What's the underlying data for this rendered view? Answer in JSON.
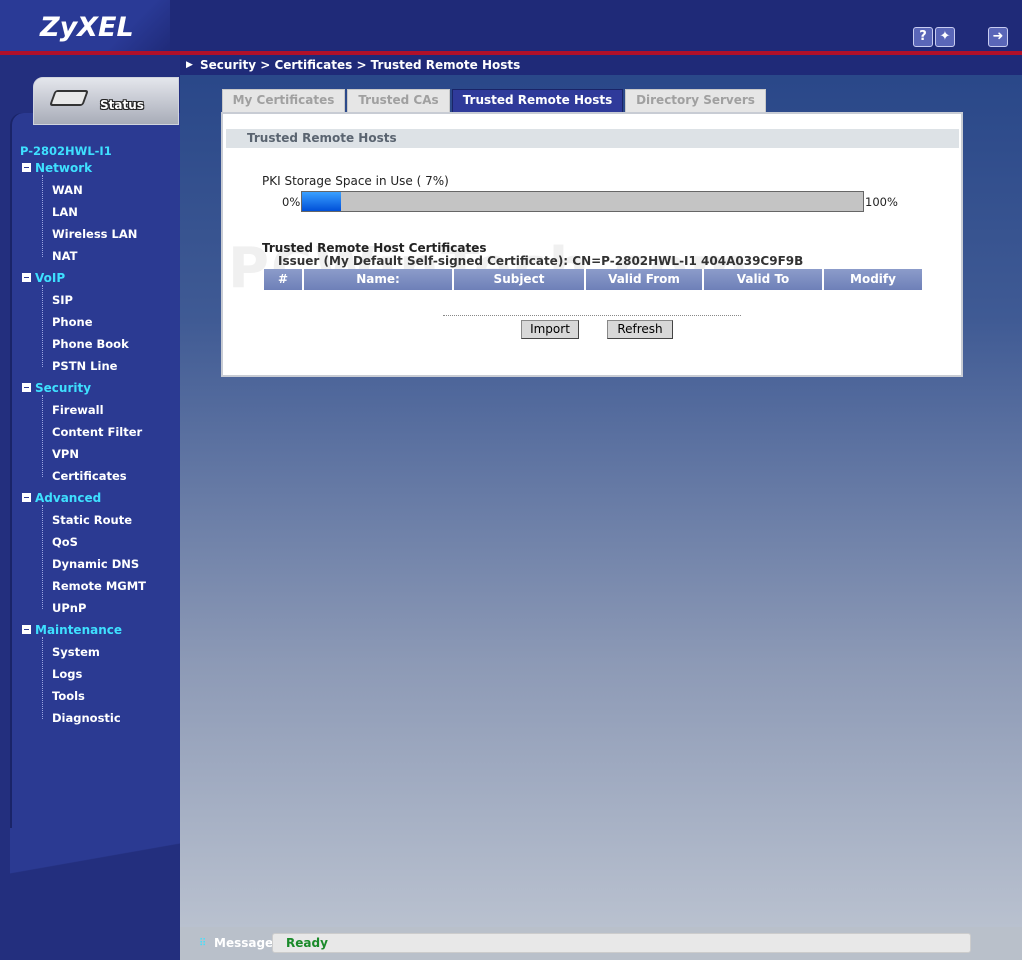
{
  "header": {
    "logo": "ZyXEL",
    "help_icon": "question-mark-icon",
    "wizard_icon": "wizard-wand-icon",
    "logout_icon": "logout-icon"
  },
  "sidebar": {
    "status_label": "Status",
    "device_name": "P-2802HWL-I1",
    "groups": [
      {
        "label": "Network",
        "items": [
          "WAN",
          "LAN",
          "Wireless LAN",
          "NAT"
        ]
      },
      {
        "label": "VoIP",
        "items": [
          "SIP",
          "Phone",
          "Phone Book",
          "PSTN Line"
        ]
      },
      {
        "label": "Security",
        "items": [
          "Firewall",
          "Content Filter",
          "VPN",
          "Certificates"
        ]
      },
      {
        "label": "Advanced",
        "items": [
          "Static Route",
          "QoS",
          "Dynamic DNS",
          "Remote MGMT",
          "UPnP"
        ]
      },
      {
        "label": "Maintenance",
        "items": [
          "System",
          "Logs",
          "Tools",
          "Diagnostic"
        ]
      }
    ]
  },
  "breadcrumb": "Security > Certificates > Trusted Remote Hosts",
  "tabs": [
    {
      "label": "My Certificates",
      "active": false
    },
    {
      "label": "Trusted CAs",
      "active": false
    },
    {
      "label": "Trusted Remote Hosts",
      "active": true
    },
    {
      "label": "Directory Servers",
      "active": false
    }
  ],
  "panel": {
    "title": "Trusted Remote Hosts",
    "pki_label": "PKI Storage Space in Use ( 7%)",
    "pki_percent": 7,
    "pct_min": "0%",
    "pct_max": "100%",
    "cert_heading": "Trusted Remote Host Certificates",
    "issuer": "Issuer (My Default Self-signed Certificate): CN=P-2802HWL-I1 404A039C9F9B",
    "columns": [
      "#",
      "Name:",
      "Subject",
      "Valid From",
      "Valid To",
      "Modify"
    ],
    "buttons": {
      "import": "Import",
      "refresh": "Refresh"
    }
  },
  "watermark": "PCWinTech.com",
  "statusbar": {
    "label": "Message",
    "text": "Ready"
  },
  "colors": {
    "accent": "#2f3a9a",
    "nav_group": "#3ee0ff",
    "ready": "#1a8a2a",
    "header_line": "#b0102a"
  }
}
